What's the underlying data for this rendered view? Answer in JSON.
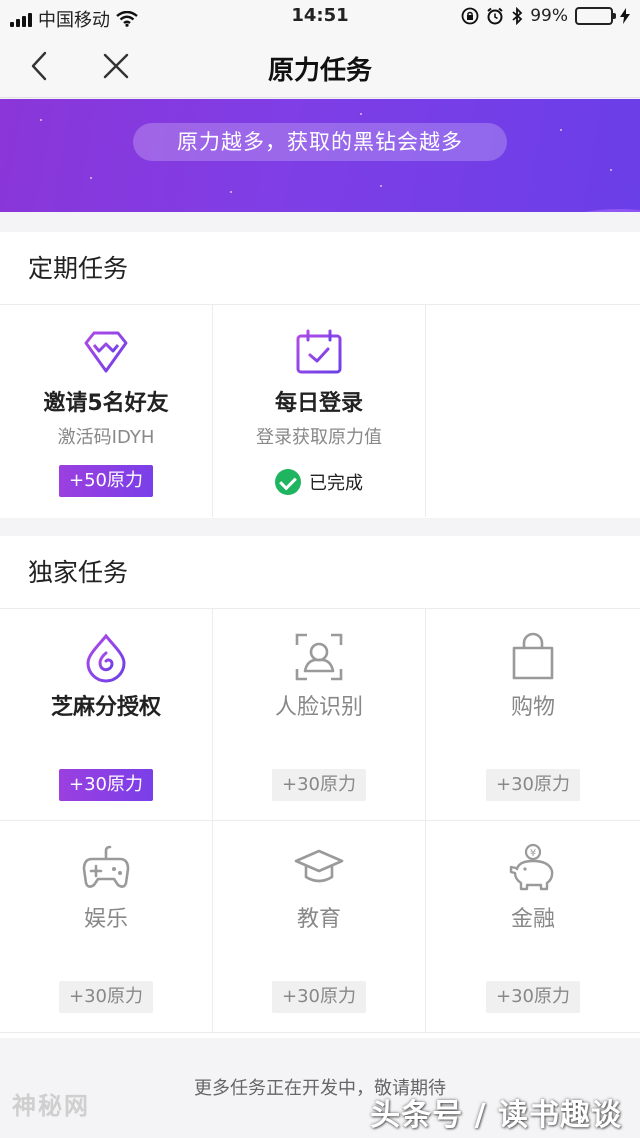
{
  "status_bar": {
    "carrier": "中国移动",
    "time": "14:51",
    "battery_percent": "99%",
    "battery_level": 0.99,
    "icons": [
      "signal-icon",
      "wifi-icon",
      "rotation-lock-icon",
      "alarm-icon",
      "bluetooth-icon",
      "battery-icon",
      "charging-icon"
    ]
  },
  "nav": {
    "title": "原力任务",
    "back_icon": "back-arrow-icon",
    "close_icon": "close-icon"
  },
  "banner": {
    "text": "原力越多，获取的黑钻会越多"
  },
  "periodic": {
    "title": "定期任务",
    "items": [
      {
        "icon": "diamond-icon",
        "name": "邀请5名好友",
        "sub": "激活码IDYH",
        "badge": "+50原力",
        "state": "active"
      },
      {
        "icon": "calendar-check-icon",
        "name": "每日登录",
        "sub": "登录获取原力值",
        "done_text": "已完成",
        "state": "done"
      }
    ]
  },
  "exclusive": {
    "title": "独家任务",
    "items": [
      {
        "icon": "sesame-drop-icon",
        "name": "芝麻分授权",
        "badge": "+30原力",
        "state": "active"
      },
      {
        "icon": "face-scan-icon",
        "name": "人脸识别",
        "badge": "+30原力",
        "state": "disabled"
      },
      {
        "icon": "shopping-bag-icon",
        "name": "购物",
        "badge": "+30原力",
        "state": "disabled"
      },
      {
        "icon": "gamepad-icon",
        "name": "娱乐",
        "badge": "+30原力",
        "state": "disabled"
      },
      {
        "icon": "graduation-cap-icon",
        "name": "教育",
        "badge": "+30原力",
        "state": "disabled"
      },
      {
        "icon": "piggy-bank-icon",
        "name": "金融",
        "badge": "+30原力",
        "state": "disabled"
      }
    ]
  },
  "footer": {
    "note": "更多任务正在开发中，敬请期待"
  },
  "watermarks": {
    "left": "神秘网",
    "right": "头条号 / 读书趣谈"
  },
  "colors": {
    "accent_purple": "#8a3fe4",
    "success_green": "#1fb45f",
    "battery_green": "#35c759"
  }
}
